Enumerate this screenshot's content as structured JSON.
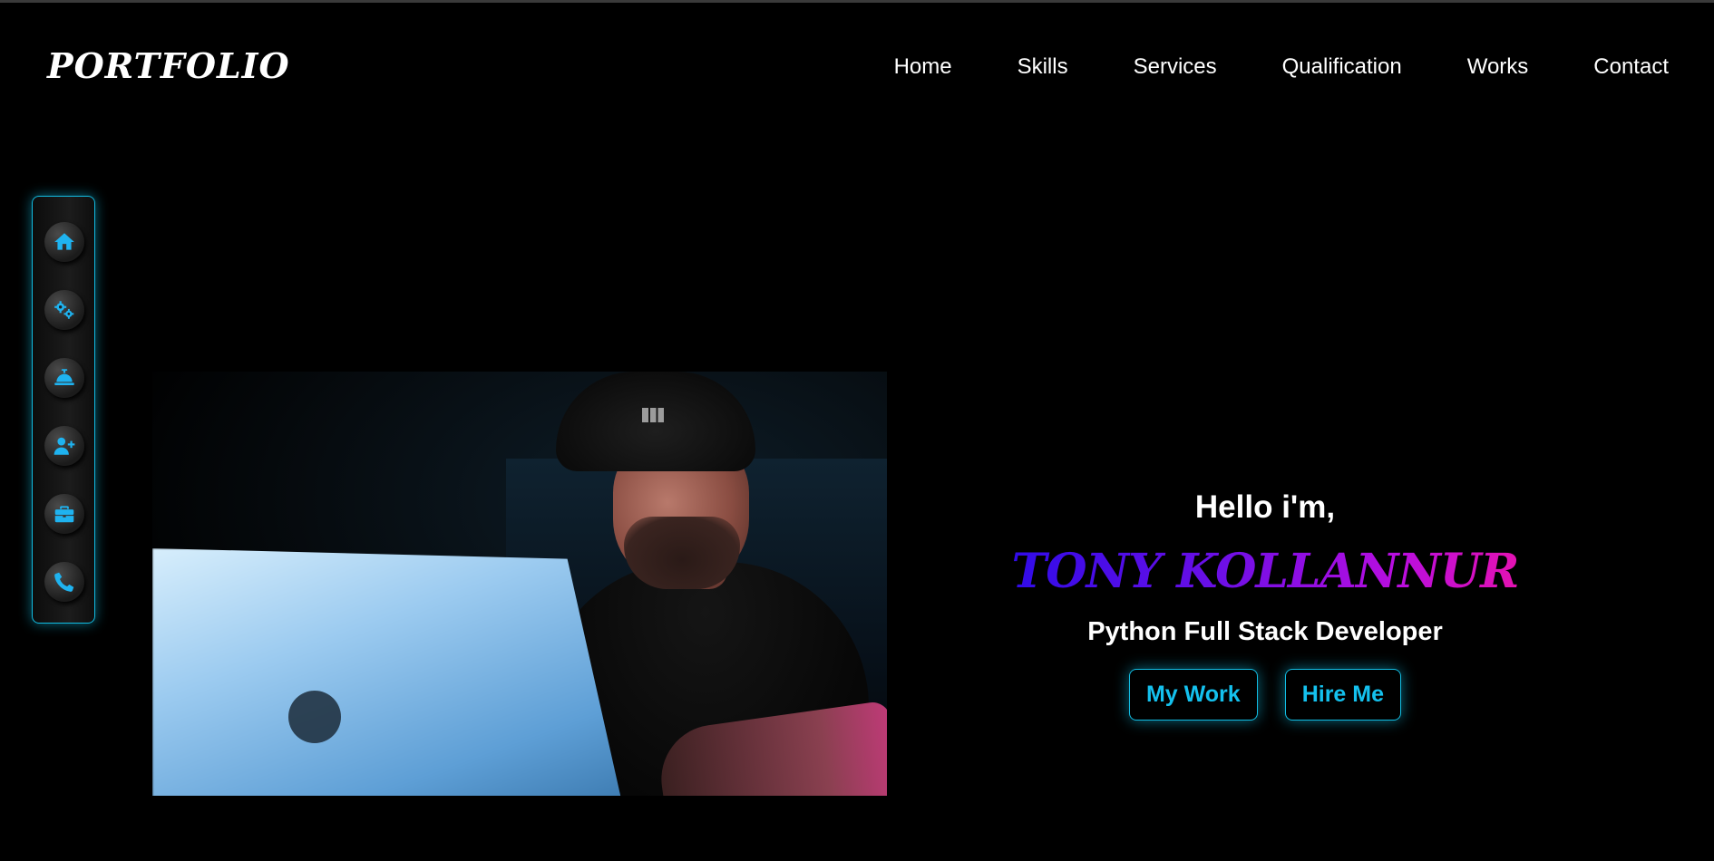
{
  "header": {
    "logo": "PORTFOLIO",
    "nav": [
      "Home",
      "Skills",
      "Services",
      "Qualification",
      "Works",
      "Contact"
    ]
  },
  "sidebar": {
    "icons": [
      "home-icon",
      "gears-icon",
      "service-bell-icon",
      "user-plus-icon",
      "briefcase-icon",
      "phone-icon"
    ]
  },
  "hero": {
    "greeting": "Hello i'm,",
    "name": "TONY KOLLANNUR",
    "role": "Python Full Stack Developer",
    "buttons": [
      "My Work",
      "Hire Me"
    ]
  },
  "colors": {
    "accent": "#12bde3",
    "icon": "#1fb3f0",
    "name_gradient_start": "#2f0be8",
    "name_gradient_end": "#e612b0"
  }
}
